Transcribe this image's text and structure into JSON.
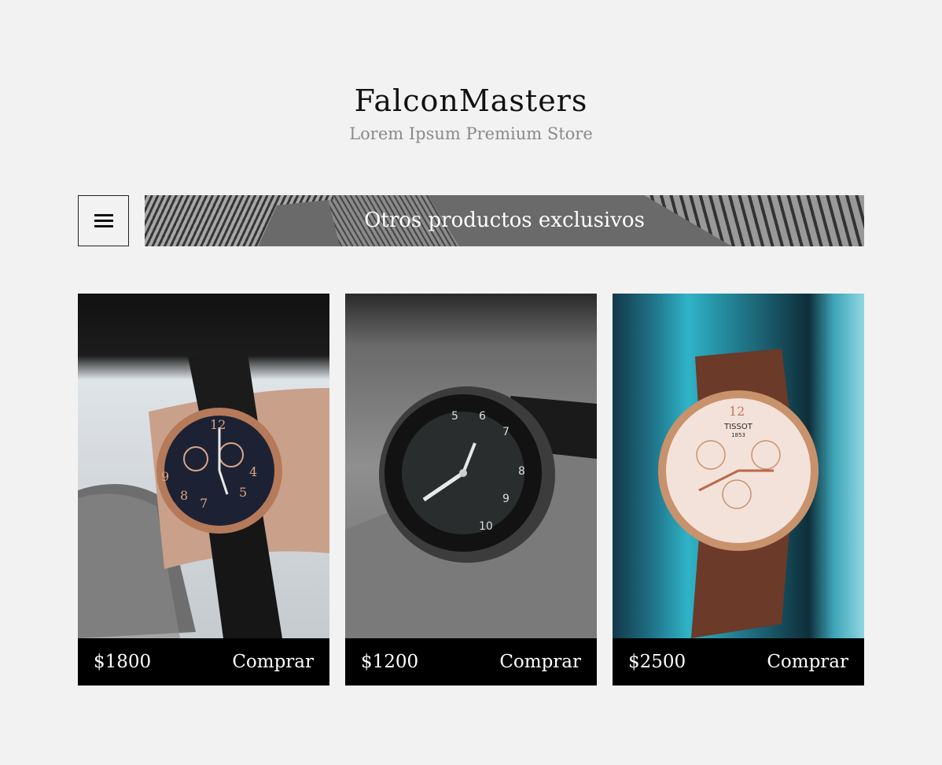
{
  "header": {
    "title": "FalconMasters",
    "subtitle": "Lorem Ipsum Premium Store"
  },
  "nav": {
    "menu_icon": "hamburger-icon",
    "banner_label": "Otros productos exclusivos"
  },
  "products": [
    {
      "price": "$1800",
      "buy_label": "Comprar",
      "image": "rose-gold-chronograph-watch-on-wrist"
    },
    {
      "price": "$1200",
      "buy_label": "Comprar",
      "image": "black-diver-watch-on-wrist"
    },
    {
      "price": "$2500",
      "buy_label": "Comprar",
      "image": "tissot-rose-gold-chronograph"
    }
  ],
  "watch3": {
    "brand": "TISSOT",
    "year": "1853"
  },
  "colors": {
    "background": "#f2f2f2",
    "card_footer": "#000000",
    "subtitle": "#8a8a8a"
  }
}
